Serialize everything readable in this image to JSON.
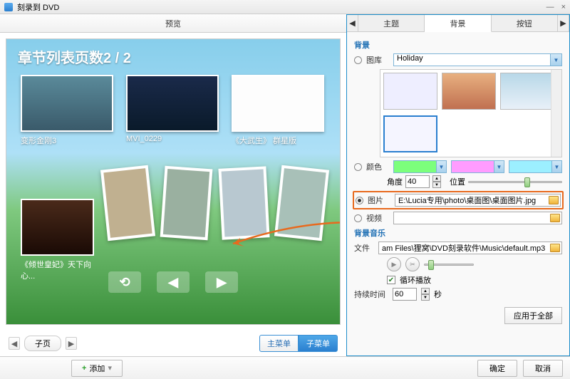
{
  "window": {
    "title": "刻录到 DVD",
    "minimize": "—",
    "close": "×"
  },
  "left": {
    "head": "预览",
    "page_title": "章节列表页数2 / 2",
    "thumbs": [
      {
        "label": "变形金刚3"
      },
      {
        "label": "MVI_0229"
      },
      {
        "label": "《大武生》 群星版"
      }
    ],
    "big_label": "《倾世皇妃》天下向心...",
    "nav": {
      "back": "⟲",
      "prev": "◀",
      "next": "▶"
    },
    "sub_nav": {
      "left": "◀",
      "mid": "子页",
      "right": "▶"
    },
    "tabs": {
      "a": "主菜单",
      "b": "子菜单"
    }
  },
  "right": {
    "tabs": {
      "theme": "主题",
      "bg": "背景",
      "button": "按钮",
      "left_tri": "◀",
      "right_tri": "▶"
    },
    "bg_section": "背景",
    "lib_label": "图库",
    "lib_value": "Holiday",
    "color_label": "颜色",
    "colors": [
      "#7CFF7C",
      "#FF9CFF",
      "#9CEFFF"
    ],
    "angle_label": "角度",
    "angle_value": "40",
    "pos_label": "位置",
    "image_label": "图片",
    "image_path": "E:\\Lucia专用\\photo\\桌面图\\桌面图片.jpg",
    "video_label": "视频",
    "music_section": "背景音乐",
    "file_label": "文件",
    "file_path": "am Files\\狸窝\\DVD刻录软件\\Music\\default.mp3",
    "loop_label": "循环播放",
    "duration_label": "持续时间",
    "duration_value": "60",
    "duration_unit": "秒",
    "apply": "应用于全部"
  },
  "footer": {
    "add": "添加",
    "dd": "▾",
    "ok": "确定",
    "cancel": "取消"
  }
}
